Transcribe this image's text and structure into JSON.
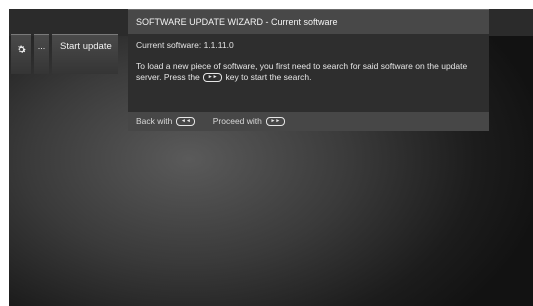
{
  "toolbar": {
    "settings_icon": "gear-icon",
    "more_label": "...",
    "start_update_label": "Start update"
  },
  "wizard": {
    "title": "SOFTWARE UPDATE WIZARD - Current software",
    "current_software_label": "Current software:",
    "current_software_version": "1.1.11.0",
    "message_part1": "To load a new piece of software, you first need to search for said software on the update server. Press the",
    "message_key": "►►",
    "message_part2": "key to start the search.",
    "footer_back_label": "Back with",
    "footer_back_key": "◄◄",
    "footer_proceed_label": "Proceed with",
    "footer_proceed_key": "►►"
  }
}
